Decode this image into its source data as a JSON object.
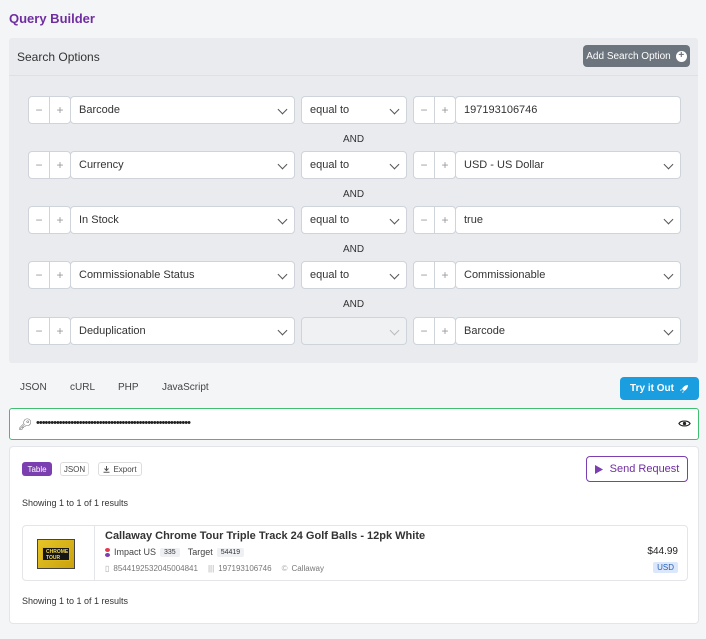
{
  "app": {
    "title": "Query Builder"
  },
  "search_options": {
    "title": "Search Options",
    "add_button": "Add Search Option",
    "rows": [
      {
        "field": "Barcode",
        "operator": "equal to",
        "value": "197193106746",
        "value_type": "text"
      },
      {
        "field": "Currency",
        "operator": "equal to",
        "value": "USD - US Dollar",
        "value_type": "select"
      },
      {
        "field": "In Stock",
        "operator": "equal to",
        "value": "true",
        "value_type": "select"
      },
      {
        "field": "Commissionable Status",
        "operator": "equal to",
        "value": "Commissionable",
        "value_type": "select"
      },
      {
        "field": "Deduplication",
        "operator": "",
        "value": "Barcode",
        "value_type": "select"
      }
    ],
    "connector": "AND",
    "minus": "−",
    "plus": "+"
  },
  "code_tabs": [
    "JSON",
    "cURL",
    "PHP",
    "JavaScript"
  ],
  "try_button": "Try it Out",
  "api_key": {
    "masked": "••••••••••••••••••••••••••••••••••••••••••••••••••••••"
  },
  "results": {
    "view_tabs": {
      "table": "Table",
      "json": "JSON",
      "export": "Export"
    },
    "send_button": "Send Request",
    "showing_top": "Showing 1 to 1 of 1 results",
    "showing_bottom": "Showing 1 to 1 of 1 results",
    "items": [
      {
        "title": "Callaway Chrome Tour Triple Track 24 Golf Balls - 12pk White",
        "thumb_label": "CHROME TOUR",
        "network": "Impact US",
        "network_id": "335",
        "merchant": "Target",
        "merchant_id": "54419",
        "sku": "8544192532045004841",
        "barcode": "197193106746",
        "brand": "Callaway",
        "price": "$44.99",
        "currency": "USD"
      }
    ]
  },
  "colors": {
    "brand": "#6f2ea0",
    "accent": "#1a9ee0",
    "key_border": "#3fbf6f"
  }
}
